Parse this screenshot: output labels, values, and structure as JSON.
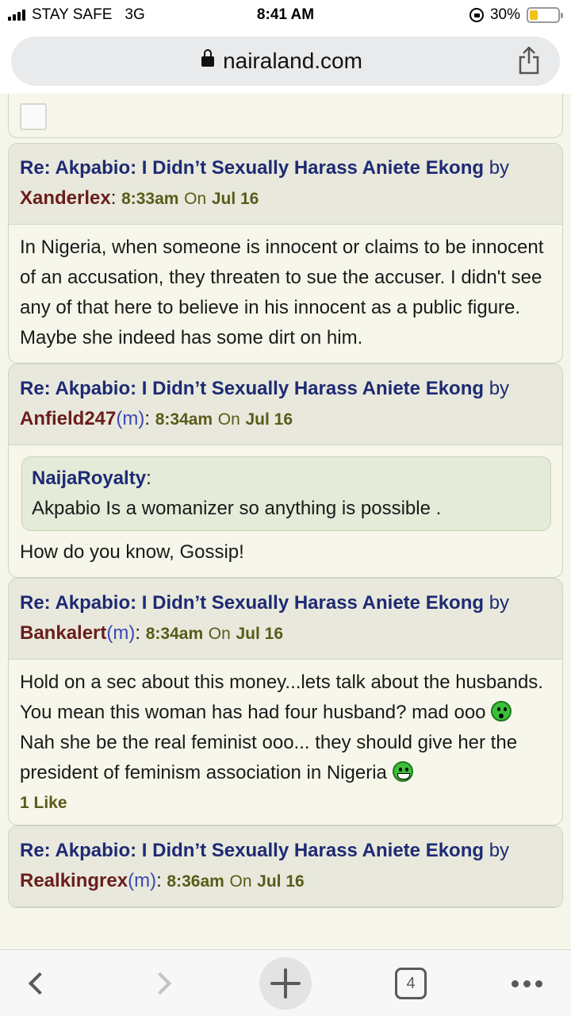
{
  "status_bar": {
    "carrier": "STAY SAFE",
    "network": "3G",
    "time": "8:41 AM",
    "battery": "30%",
    "battery_level": 0.3
  },
  "browser": {
    "url": "nairaland.com",
    "tab_count": "4"
  },
  "posts": [
    {
      "title": "Re: Akpabio: I Didn’t Sexually Harass Aniete Ekong",
      "by": "by",
      "user": "Xanderlex",
      "time": "8:33am",
      "on": "On",
      "date": "Jul 16",
      "body": "In Nigeria, when someone is innocent or claims to be innocent of an accusation, they threaten to sue the accuser. I didn't see any of that here to believe in his innocent as a public figure. Maybe she indeed has some dirt on him."
    },
    {
      "title": "Re: Akpabio: I Didn’t Sexually Harass Aniete Ekong",
      "by": "by",
      "user": "Anfield247",
      "gender": "m",
      "time": "8:34am",
      "on": "On",
      "date": "Jul 16",
      "quote_user": "NaijaRoyalty",
      "quote_text": "Akpabio Is a womanizer so anything is possible .",
      "body": "How do you know, Gossip!"
    },
    {
      "title": "Re: Akpabio: I Didn’t Sexually Harass Aniete Ekong",
      "by": "by",
      "user": "Bankalert",
      "gender": "m",
      "time": "8:34am",
      "on": "On",
      "date": "Jul 16",
      "body_part1": "Hold on a sec about this money...lets talk about the husbands. You mean this woman has had four husband? mad ooo",
      "body_part2": "Nah she be the real feminist ooo... they should give her the president of feminism association in Nigeria",
      "likes": "1 Like"
    },
    {
      "title": "Re: Akpabio: I Didn’t Sexually Harass Aniete Ekong",
      "by": "by",
      "user": "Realkingrex",
      "gender": "m",
      "time": "8:36am",
      "on": "On",
      "date": "Jul 16"
    }
  ]
}
